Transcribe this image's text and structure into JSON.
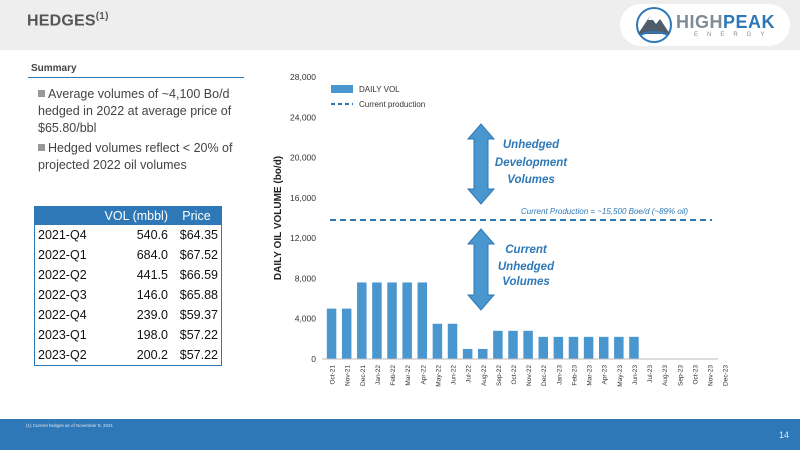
{
  "header": {
    "title": "HEDGES",
    "title_sup": "(1)",
    "logo_high": "HIGH",
    "logo_peak": "PEAK",
    "logo_sub": "ENERGY"
  },
  "summary": {
    "label": "Summary",
    "bullets": [
      "Average volumes of ~4,100 Bo/d hedged in 2022 at average price of $65.80/bbl",
      "Hedged volumes reflect < 20% of projected 2022 oil volumes"
    ]
  },
  "hedge_table": {
    "headers": [
      "",
      "VOL (mbbl)",
      "Price"
    ],
    "rows": [
      [
        "2021-Q4",
        "540.6",
        "$64.35"
      ],
      [
        "2022-Q1",
        "684.0",
        "$67.52"
      ],
      [
        "2022-Q2",
        "441.5",
        "$66.59"
      ],
      [
        "2022-Q3",
        "146.0",
        "$65.88"
      ],
      [
        "2022-Q4",
        "239.0",
        "$59.37"
      ],
      [
        "2023-Q1",
        "198.0",
        "$57.22"
      ],
      [
        "2023-Q2",
        "200.2",
        "$57.22"
      ]
    ]
  },
  "chart_data": {
    "type": "bar",
    "ylabel": "DAILY OIL VOLUME (bo/d)",
    "ylim": [
      0,
      28000
    ],
    "yticks": [
      "0",
      "4,000",
      "8,000",
      "12,000",
      "16,000",
      "20,000",
      "24,000",
      "28,000"
    ],
    "ytick_values": [
      0,
      4000,
      8000,
      12000,
      16000,
      20000,
      24000,
      28000
    ],
    "categories": [
      "Oct-21",
      "Nov-21",
      "Dec-21",
      "Jan-22",
      "Feb-22",
      "Mar-22",
      "Apr-22",
      "May-22",
      "Jun-22",
      "Jul-22",
      "Aug-22",
      "Sep-22",
      "Oct-22",
      "Nov-22",
      "Dec-22",
      "Jan-23",
      "Feb-23",
      "Mar-23",
      "Apr-23",
      "May-23",
      "Jun-23",
      "Jul-23",
      "Aug-23",
      "Sep-23",
      "Oct-23",
      "Nov-23",
      "Dec-23"
    ],
    "series": [
      {
        "name": "DAILY VOL",
        "color": "#4a96cf",
        "values": [
          5000,
          5000,
          7600,
          7600,
          7600,
          7600,
          7600,
          3500,
          3500,
          1000,
          1000,
          2800,
          2800,
          2800,
          2200,
          2200,
          2200,
          2200,
          2200,
          2200,
          2200,
          0,
          0,
          0,
          0,
          0,
          0
        ]
      }
    ],
    "reference_line": {
      "name": "Current production",
      "value": 13800,
      "color": "#2e78b7",
      "label": "Current Production = ~15,500 Boe/d (~89% oil)"
    },
    "annotations": {
      "unhedged": [
        "Unhedged",
        "Development",
        "Volumes"
      ],
      "current": [
        "Current",
        "Unhedged",
        "Volumes"
      ]
    },
    "legend_position": "top-left",
    "grid": false
  },
  "footer": {
    "footnote": "(1)  Current hedges as of November 9, 2021",
    "page_number": "14"
  },
  "colors": {
    "accent": "#2e78b7",
    "bar": "#4a96cf"
  }
}
